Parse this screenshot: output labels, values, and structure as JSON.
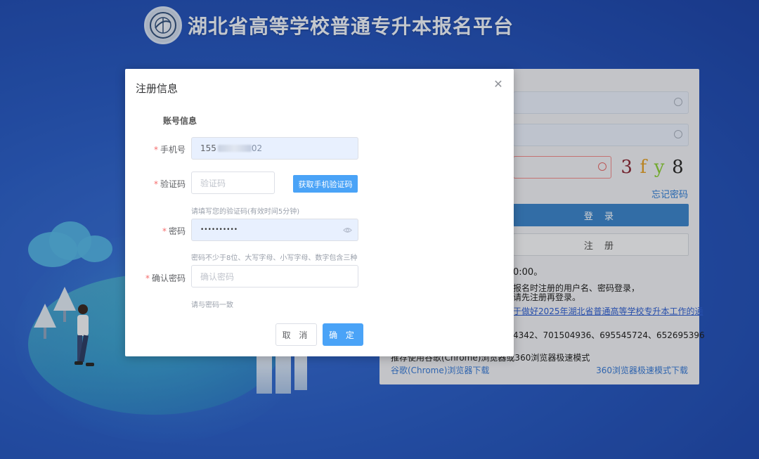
{
  "header": {
    "title": "湖北省高等学校普通专升本报名平台",
    "logo_icon": "university-seal-icon"
  },
  "login": {
    "captcha": [
      "3",
      "f",
      "y",
      "8"
    ],
    "forgot_password": "忘记密码",
    "login_button": "登 录",
    "register_button": "注 册",
    "time_fragment": "0:00。",
    "notice_line1": "报名时注册的用户名、密码登录，",
    "notice_line2": "请先注册再登录。",
    "notice_link": "于做好2025年湖北省普通高等学校专升本工作的通",
    "qq_groups": "4342、701504936、695545724、652695396",
    "browser_tip": "推荐使用谷歌(Chrome)浏览器或360浏览器极速模式",
    "chrome_download": "谷歌(Chrome)浏览器下载",
    "browser360_download": "360浏览器极速模式下载"
  },
  "dialog": {
    "title": "注册信息",
    "section_title": "账号信息",
    "phone": {
      "label": "手机号",
      "value_visible": "155",
      "value_tail": "02"
    },
    "code": {
      "label": "验证码",
      "placeholder": "验证码",
      "sms_button": "获取手机验证码",
      "hint": "请填写您的验证码(有效时间5分钟)"
    },
    "password": {
      "label": "密码",
      "value_masked": "••••••••••",
      "hint": "密码不少于8位、大写字母、小写字母、数字包含三种"
    },
    "confirm": {
      "label": "确认密码",
      "placeholder": "确认密码",
      "hint": "请与密码一致"
    },
    "cancel_button": "取 消",
    "ok_button": "确 定"
  },
  "colors": {
    "primary": "#4aa3f7",
    "required": "#f56c6c",
    "login_button": "#3e85cb",
    "background": "#2b5dc4"
  }
}
